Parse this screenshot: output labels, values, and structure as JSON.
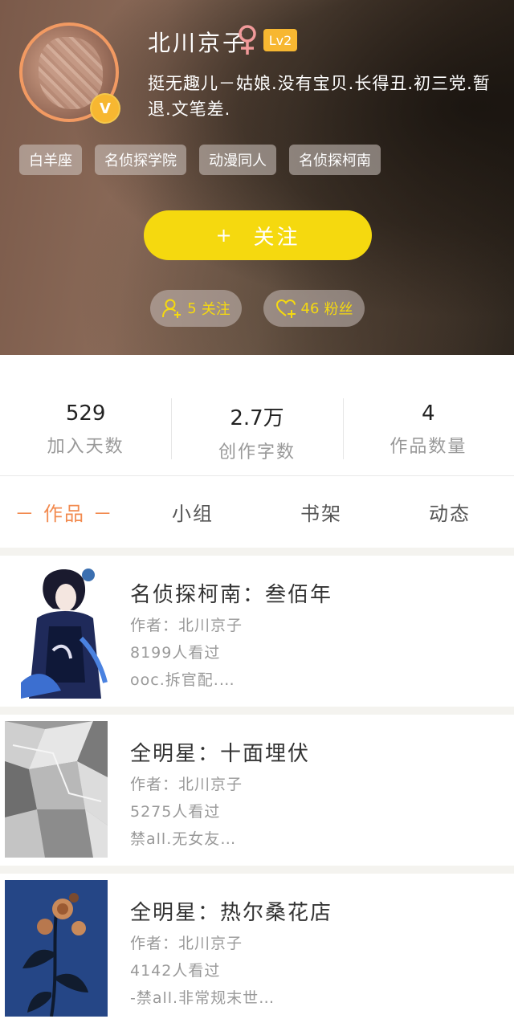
{
  "profile": {
    "username": "北川京子",
    "level": "Lv2",
    "verified_badge": "V",
    "bio": "挺无趣儿－姑娘.没有宝贝.长得丑.初三党.暂退.文笔差.",
    "tags": [
      "白羊座",
      "名侦探学院",
      "动漫同人",
      "名侦探柯南"
    ],
    "follow_button": {
      "plus": "+",
      "label": "关注"
    },
    "following": {
      "count": "5",
      "label": "关注"
    },
    "fans": {
      "count": "46",
      "label": "粉丝"
    }
  },
  "stats": [
    {
      "value": "529",
      "label": "加入天数"
    },
    {
      "value": "2.7万",
      "label": "创作字数"
    },
    {
      "value": "4",
      "label": "作品数量"
    }
  ],
  "tabs": [
    "－ 作品 －",
    "小组",
    "书架",
    "动态"
  ],
  "books": [
    {
      "title": "名侦探柯南：叁佰年",
      "author": "作者：北川京子",
      "views": "8199人看过",
      "desc": "ooc.拆官配.…"
    },
    {
      "title": "全明星：十面埋伏",
      "author": "作者：北川京子",
      "views": "5275人看过",
      "desc": "禁all.无女友…"
    },
    {
      "title": "全明星：热尔桑花店",
      "author": "作者：北川京子",
      "views": "4142人看过",
      "desc": "-禁all.非常规末世…"
    }
  ],
  "colors": {
    "accent": "#f28b50",
    "follow_button": "#f5d90f",
    "badge": "#f7b731",
    "gender": "#f29a9a"
  },
  "icons": [
    "female-icon",
    "add-user-icon",
    "heart-plus-icon",
    "verified-icon"
  ]
}
